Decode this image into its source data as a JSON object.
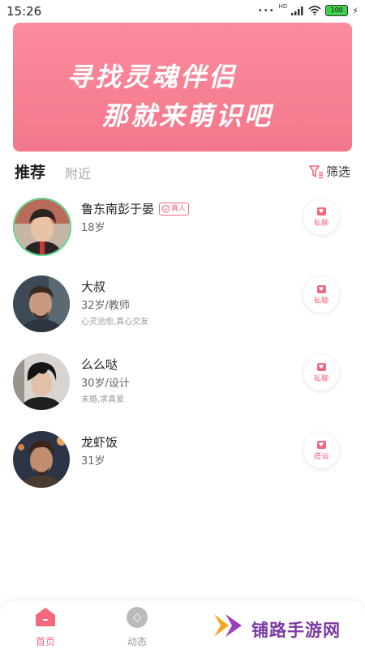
{
  "status_bar": {
    "time": "15:26",
    "network": "HD",
    "battery": "100"
  },
  "banner": {
    "line1": "寻找灵魂伴侣",
    "line2": "那就来萌识吧"
  },
  "tabs": {
    "recommend": "推荐",
    "nearby": "附近",
    "filter": "筛选"
  },
  "users": [
    {
      "name": "鲁东南彭于晏",
      "badge": "真人",
      "info": "18岁",
      "desc": "",
      "action": "私聊"
    },
    {
      "name": "大叔",
      "badge": "",
      "info": "32岁/教师",
      "desc": "心灵治愈,真心交友",
      "action": "私聊"
    },
    {
      "name": "么么哒",
      "badge": "",
      "info": "30岁/设计",
      "desc": "未婚,求真爱",
      "action": "私聊"
    },
    {
      "name": "龙虾饭",
      "badge": "",
      "info": "31岁",
      "desc": "",
      "action": "搭讪"
    }
  ],
  "bottom_nav": {
    "home": "首页",
    "moments": "动态"
  },
  "watermark": {
    "text": "铺路手游网"
  },
  "colors": {
    "accent": "#f2687d",
    "banner": "#f7818f"
  }
}
